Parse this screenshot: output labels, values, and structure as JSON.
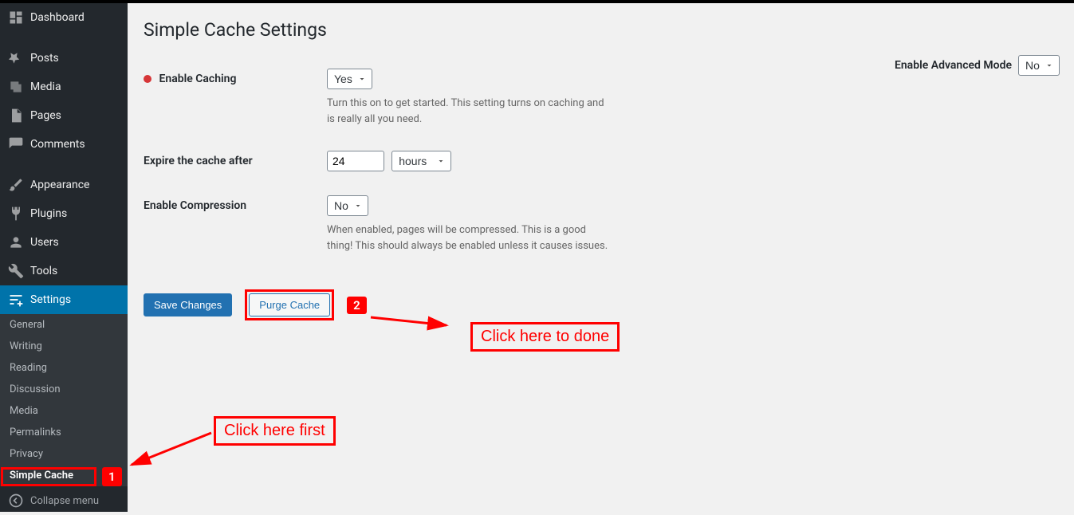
{
  "sidebar": {
    "items": [
      {
        "label": "Dashboard"
      },
      {
        "label": "Posts"
      },
      {
        "label": "Media"
      },
      {
        "label": "Pages"
      },
      {
        "label": "Comments"
      },
      {
        "label": "Appearance"
      },
      {
        "label": "Plugins"
      },
      {
        "label": "Users"
      },
      {
        "label": "Tools"
      },
      {
        "label": "Settings"
      }
    ],
    "submenu": {
      "items": [
        {
          "label": "General"
        },
        {
          "label": "Writing"
        },
        {
          "label": "Reading"
        },
        {
          "label": "Discussion"
        },
        {
          "label": "Media"
        },
        {
          "label": "Permalinks"
        },
        {
          "label": "Privacy"
        },
        {
          "label": "Simple Cache"
        }
      ]
    },
    "collapse_label": "Collapse menu"
  },
  "page": {
    "title": "Simple Cache Settings",
    "advanced_mode_label": "Enable Advanced Mode",
    "advanced_mode_value": "No"
  },
  "form": {
    "enable_caching_label": "Enable Caching",
    "enable_caching_value": "Yes",
    "enable_caching_desc": "Turn this on to get started. This setting turns on caching and is really all you need.",
    "expire_label": "Expire the cache after",
    "expire_value": "24",
    "expire_unit": "hours",
    "compression_label": "Enable Compression",
    "compression_value": "No",
    "compression_desc": "When enabled, pages will be compressed. This is a good thing! This should always be enabled unless it causes issues."
  },
  "buttons": {
    "save": "Save Changes",
    "purge": "Purge Cache"
  },
  "annotations": {
    "badge1": "1",
    "badge2": "2",
    "text1": "Click here first",
    "text2": "Click here to done"
  }
}
